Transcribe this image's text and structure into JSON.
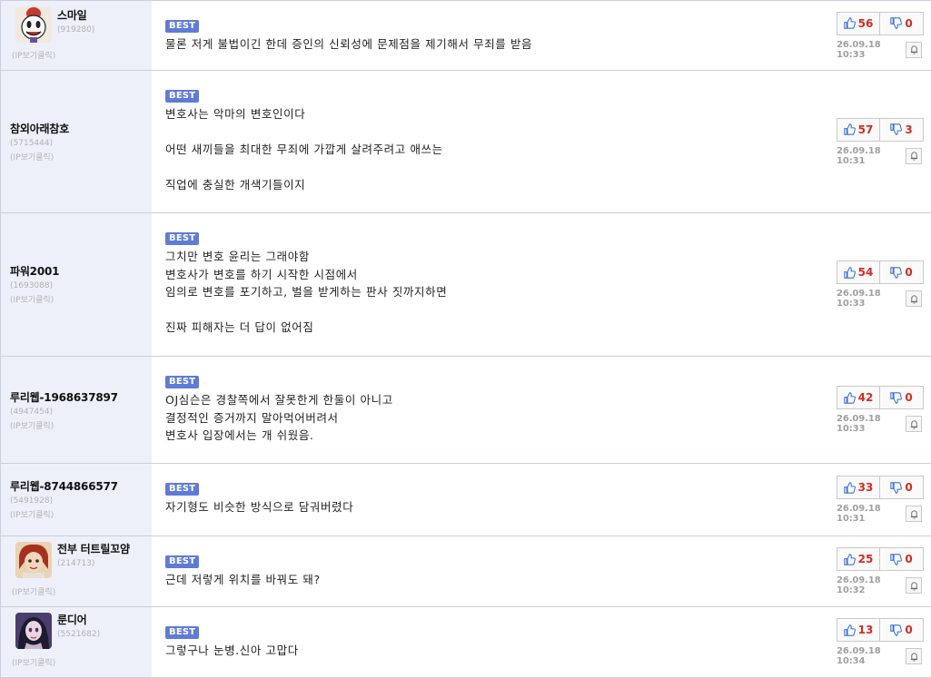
{
  "comments": [
    {
      "nick": "스마일",
      "uid": "(919280)",
      "ip": "(IP보기클릭)",
      "best": "BEST",
      "text": "물론 저게 불법이긴 한데 증인의 신뢰성에 문제점을 제기해서 무죄를 받음",
      "up": "56",
      "down": "0",
      "date": "26.09.18 10:33",
      "avatar": "cuphead"
    },
    {
      "nick": "참외아래참호",
      "uid": "(5715444)",
      "ip": "(IP보기클릭)",
      "best": "BEST",
      "text": "변호사는 악마의 변호인이다\n\n어떤 새끼들을 최대한 무죄에 가깝게 살려주려고 애쓰는\n\n직업에 충실한 개색기들이지",
      "up": "57",
      "down": "3",
      "date": "26.09.18 10:31"
    },
    {
      "nick": "파워2001",
      "uid": "(1693088)",
      "ip": "(IP보기클릭)",
      "best": "BEST",
      "text": "그치만 변호 윤리는 그래야함\n변호사가 변호를 하기 시작한 시점에서\n임의로 변호를 포기하고, 벌을 받게하는 판사 짓까지하면\n\n진짜 피해자는 더 답이 없어짐",
      "up": "54",
      "down": "0",
      "date": "26.09.18 10:33"
    },
    {
      "nick": "루리웹-1968637897",
      "uid": "(4947454)",
      "ip": "(IP보기클릭)",
      "best": "BEST",
      "text": "OJ심슨은 경찰쪽에서 잘못한게 한둘이 아니고\n결정적인 증거까지 말아먹어버려서\n변호사 입장에서는 개 쉬웠음.",
      "up": "42",
      "down": "0",
      "date": "26.09.18 10:33"
    },
    {
      "nick": "루리웹-8744866577",
      "uid": "(5491928)",
      "ip": "(IP보기클릭)",
      "best": "BEST",
      "text": "자기형도 비슷한 방식으로 담궈버렸다",
      "up": "33",
      "down": "0",
      "date": "26.09.18 10:31"
    },
    {
      "nick": "전부 터트릴꼬얌",
      "uid": "(214713)",
      "ip": "(IP보기클릭)",
      "best": "BEST",
      "text": "근데 저렇게 위치를 바꿔도 돼?",
      "up": "25",
      "down": "0",
      "date": "26.09.18 10:32",
      "avatar": "redhair"
    },
    {
      "nick": "룬디어",
      "uid": "(5521682)",
      "ip": "(IP보기클릭)",
      "best": "BEST",
      "text": "그렇구나 눈병.신아 고맙다",
      "up": "13",
      "down": "0",
      "date": "26.09.18 10:34",
      "avatar": "darkhair"
    }
  ],
  "icons": {
    "up": "thumbs-up-icon",
    "down": "thumbs-down-icon",
    "report": "bell-icon"
  },
  "colors": {
    "best_badge": "#5f7bd6",
    "vote_count": "#d32c22",
    "sidebar_bg": "#edf0f9",
    "up_icon": "#3a6fd4"
  }
}
